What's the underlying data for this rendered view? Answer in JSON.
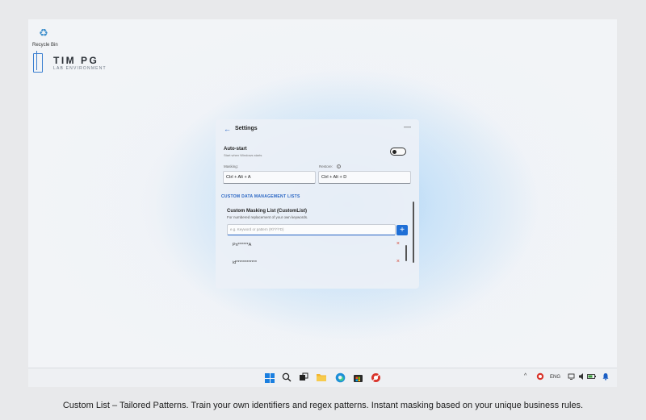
{
  "desktop": {
    "recycle_bin_label": "Recycle Bin",
    "logo_title": "TIM PG",
    "logo_subtitle": "LAB ENVIRONMENT"
  },
  "settings": {
    "title": "Settings",
    "autostart": {
      "label": "Auto-start",
      "description": "Start when Windows starts",
      "enabled": false
    },
    "masking": {
      "label": "Masking:",
      "value": "Ctrl + Alt + A"
    },
    "restore": {
      "label": "Restore:",
      "value": "Ctrl + Alt + D"
    },
    "section_heading": "CUSTOM DATA MANAGEMENT LISTS",
    "custom_list": {
      "title": "Custom Masking List (CustomList)",
      "description": "For numbered replacement of your own keywords.",
      "input_placeholder": "e.g. Keyword or pattern (R\\*\\*\\*D)",
      "add_label": "+",
      "entries": [
        {
          "value": "Pri******A",
          "delete": "×"
        },
        {
          "value": "id************",
          "delete": "×"
        }
      ]
    }
  },
  "taskbar": {
    "icons": [
      "windows-start-icon",
      "search-icon",
      "task-view-icon",
      "file-explorer-icon",
      "edge-browser-icon",
      "microsoft-store-icon",
      "app-icon"
    ],
    "tray_chevron": "^",
    "language": "ENG"
  },
  "caption": "Custom List – Tailored Patterns. Train your own identifiers and regex patterns. Instant masking based on your unique business rules.",
  "colors": {
    "accent": "#1f6fd6",
    "section_heading": "#2462c2",
    "delete": "#d64a3a"
  }
}
